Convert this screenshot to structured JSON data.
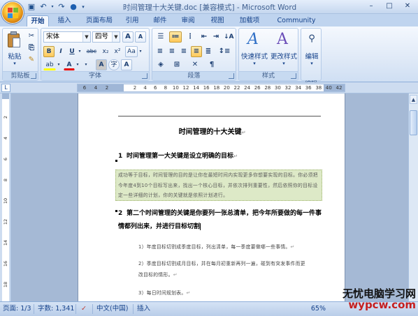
{
  "window": {
    "title": "时间管理十大关键.doc [兼容模式] - Microsoft Word",
    "controls": {
      "minimize": "–",
      "maximize": "□",
      "close": "✕"
    }
  },
  "quick_access": {
    "save_icon": "save-icon",
    "undo_icon": "undo-icon",
    "redo_icon": "redo-icon"
  },
  "tabs": [
    {
      "label": "开始",
      "active": true
    },
    {
      "label": "插入"
    },
    {
      "label": "页面布局"
    },
    {
      "label": "引用"
    },
    {
      "label": "邮件"
    },
    {
      "label": "审阅"
    },
    {
      "label": "视图"
    },
    {
      "label": "加载项"
    },
    {
      "label": "Community Clips"
    }
  ],
  "ribbon": {
    "clipboard": {
      "group_label": "剪贴板",
      "paste_label": "粘贴"
    },
    "font": {
      "group_label": "字体",
      "font_name": "宋体",
      "font_size": "四号",
      "bold": "B",
      "italic": "I",
      "underline": "U",
      "strike": "abc",
      "subscript": "x₂",
      "superscript": "x²",
      "case": "Aa",
      "clear": "A",
      "grow": "A",
      "shrink": "A",
      "highlight": "ab",
      "color": "A",
      "char_shade": "A",
      "char_border": "A",
      "enclose": "字"
    },
    "paragraph": {
      "group_label": "段落"
    },
    "styles": {
      "group_label": "样式",
      "quick_styles": "快速样式",
      "change_styles": "更改样式"
    },
    "editing": {
      "group_label": "编辑",
      "edit_label": "编辑"
    }
  },
  "ruler": {
    "left_marks": [
      "6",
      "4",
      "2"
    ],
    "right_marks": [
      "2",
      "4",
      "6",
      "8",
      "10",
      "12",
      "14",
      "16",
      "18",
      "20",
      "22",
      "24",
      "26",
      "28",
      "30",
      "32",
      "34",
      "36",
      "38",
      "40",
      "42"
    ],
    "tab_selector": "L"
  },
  "document": {
    "title": "时间管理的十大关键",
    "heading1": {
      "num": "1",
      "text": "时间管理第一大关键是设立明确的目标"
    },
    "shaded_paragraph": "成功等于目标，时间管理的目的是让你在最短时间内实现更多你想要实现的目标。你必须把今年度4到10个目标写出来，找出一个核心目标，并依次排列重要性，然后依照你的目标设定一些详细的计划，你的关键就是依照计划进行。",
    "heading2": {
      "num": "2",
      "line1": "第二个时间管理的关键是你要列一张总清单，把今年所要做的每一件事",
      "line2": "情都列出来，并进行目标切割"
    },
    "items": [
      "1）年度目标切割成季度目标，列出清单，每一季度要做哪一些事情。",
      "2）季度目标切割成月目标，并在每月初重新再列一遍，碰到有突发事件而更",
      "改目标的情形。",
      "3）每日时间规划表。"
    ],
    "para_mark": "↵"
  },
  "status": {
    "page": "页面: 1/3",
    "words": "字数: 1,341",
    "language": "中文(中国)",
    "mode": "插入",
    "zoom": "65%"
  },
  "watermark": {
    "line1": "无忧电脑学习网",
    "line2": "wypcw.com"
  }
}
